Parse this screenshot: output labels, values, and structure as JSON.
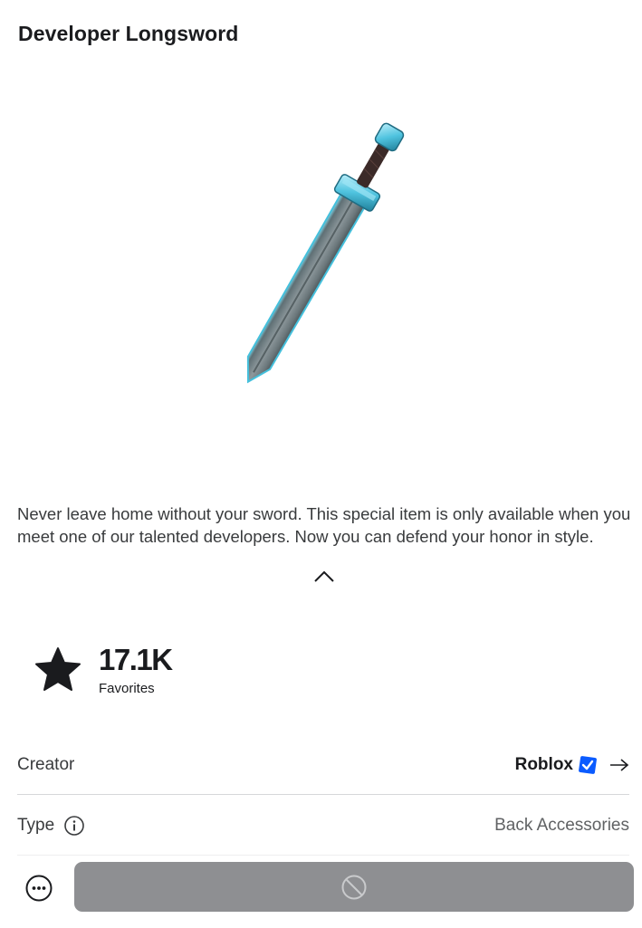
{
  "item": {
    "title": "Developer Longsword",
    "description": "Never leave home without your sword. This special item is only available when you meet one of our talented developers. Now you can defend your honor in style."
  },
  "favorites": {
    "count": "17.1K",
    "label": "Favorites",
    "icon": "star-icon"
  },
  "details": {
    "creator_label": "Creator",
    "creator_name": "Roblox",
    "creator_verified": true,
    "type_label": "Type",
    "type_value": "Back Accessories"
  },
  "icons": {
    "collapse": "chevron-up-icon",
    "verified": "verified-badge-icon",
    "creator_link": "arrow-right-icon",
    "type_info": "info-icon",
    "more": "more-options-icon",
    "buy": "unavailable-icon"
  },
  "colors": {
    "verified_badge": "#0b5bff",
    "buy_button_disabled": "#8e8f92",
    "sword_accent": "#5ec8e0"
  }
}
